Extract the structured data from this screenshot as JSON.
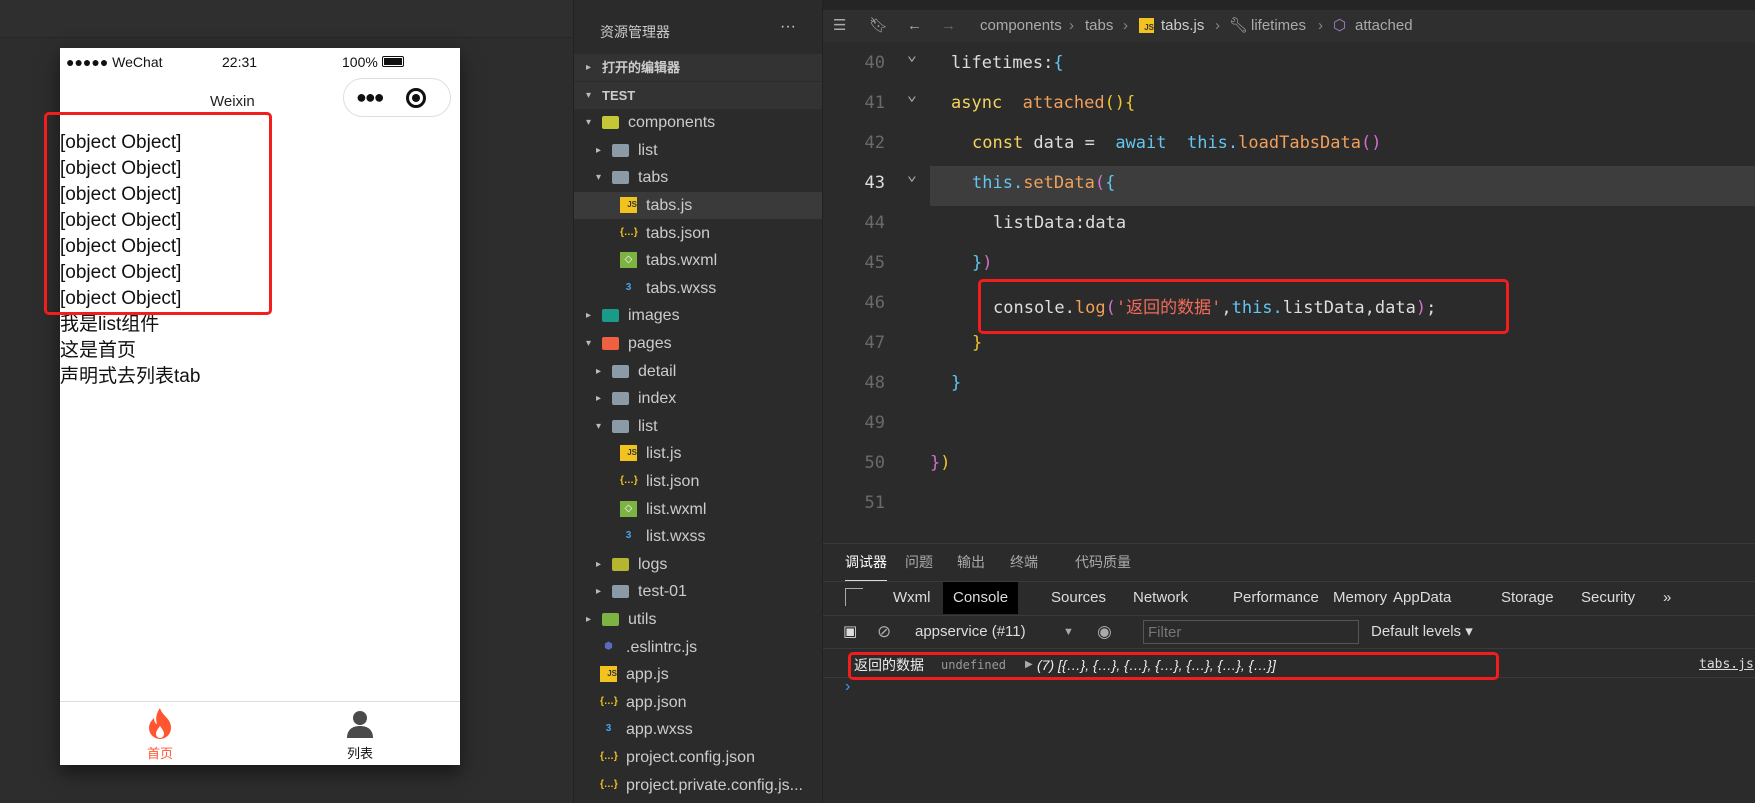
{
  "simulator": {
    "status": {
      "signal": "●●●●● WeChat",
      "time": "22:31",
      "battery": "100%"
    },
    "nav_title": "Weixin",
    "capsule_icons": [
      "more-icon",
      "record-icon"
    ],
    "content_lines": [
      "[object Object]",
      "[object Object]",
      "[object Object]",
      "[object Object]",
      "[object Object]",
      "[object Object]",
      "[object Object]",
      "我是list组件",
      "这是首页",
      "声明式去列表tab"
    ],
    "tabbar": [
      {
        "label": "首页",
        "icon": "fire-icon",
        "active": true,
        "color": "#ff5530"
      },
      {
        "label": "列表",
        "icon": "user-icon",
        "active": false,
        "color": "#111111"
      }
    ]
  },
  "explorer": {
    "title": "资源管理器",
    "more": "···",
    "rows": [
      {
        "label": "打开的编辑器",
        "type": "section",
        "arrow": "▸",
        "level": 0
      },
      {
        "label": "TEST",
        "type": "section",
        "arrow": "▾",
        "level": 0
      },
      {
        "label": "components",
        "type": "folder-open",
        "arrow": "▾",
        "level": 1,
        "icon_color": "#c6c736"
      },
      {
        "label": "list",
        "type": "folder",
        "arrow": "▸",
        "level": 2,
        "icon_color": "#8a9aa6"
      },
      {
        "label": "tabs",
        "type": "folder-open",
        "arrow": "▾",
        "level": 2,
        "icon_color": "#8a9aa6"
      },
      {
        "label": "tabs.js",
        "type": "js",
        "level": 3,
        "selected": true
      },
      {
        "label": "tabs.json",
        "type": "json",
        "level": 3
      },
      {
        "label": "tabs.wxml",
        "type": "wxml",
        "level": 3
      },
      {
        "label": "tabs.wxss",
        "type": "wxss",
        "level": 3
      },
      {
        "label": "images",
        "type": "folder",
        "arrow": "▸",
        "level": 1,
        "icon_color": "#1a9a88"
      },
      {
        "label": "pages",
        "type": "folder-open",
        "arrow": "▾",
        "level": 1,
        "icon_color": "#f06040"
      },
      {
        "label": "detail",
        "type": "folder",
        "arrow": "▸",
        "level": 2,
        "icon_color": "#8a9aa6"
      },
      {
        "label": "index",
        "type": "folder",
        "arrow": "▸",
        "level": 2,
        "icon_color": "#8a9aa6"
      },
      {
        "label": "list",
        "type": "folder-open",
        "arrow": "▾",
        "level": 2,
        "icon_color": "#8a9aa6"
      },
      {
        "label": "list.js",
        "type": "js",
        "level": 3
      },
      {
        "label": "list.json",
        "type": "json",
        "level": 3
      },
      {
        "label": "list.wxml",
        "type": "wxml",
        "level": 3
      },
      {
        "label": "list.wxss",
        "type": "wxss",
        "level": 3
      },
      {
        "label": "logs",
        "type": "folder",
        "arrow": "▸",
        "level": 2,
        "icon_color": "#b5b530"
      },
      {
        "label": "test-01",
        "type": "folder",
        "arrow": "▸",
        "level": 2,
        "icon_color": "#8a9aa6"
      },
      {
        "label": "utils",
        "type": "folder",
        "arrow": "▸",
        "level": 1,
        "icon_color": "#7cb342"
      },
      {
        "label": ".eslintrc.js",
        "type": "eslint",
        "level": 1
      },
      {
        "label": "app.js",
        "type": "js",
        "level": 1
      },
      {
        "label": "app.json",
        "type": "json",
        "level": 1
      },
      {
        "label": "app.wxss",
        "type": "wxss",
        "level": 1
      },
      {
        "label": "project.config.json",
        "type": "json",
        "level": 1
      },
      {
        "label": "project.private.config.js...",
        "type": "json",
        "level": 1
      }
    ]
  },
  "editor": {
    "breadcrumb": [
      "components",
      "tabs",
      "tabs.js",
      "lifetimes",
      "attached"
    ],
    "current_line": 43,
    "lines": [
      {
        "n": 40,
        "fold": true,
        "indent": 1,
        "tokens": [
          [
            "lifetimes:",
            "df"
          ],
          [
            "{",
            "cy"
          ]
        ]
      },
      {
        "n": 41,
        "fold": true,
        "indent": 1,
        "tokens": [
          [
            "async",
            "kw"
          ],
          [
            "  ",
            "df"
          ],
          [
            "attached",
            "fn"
          ],
          [
            "()",
            "yl"
          ],
          [
            "{",
            "yl"
          ]
        ]
      },
      {
        "n": 42,
        "indent": 2,
        "tokens": [
          [
            "const",
            "kw"
          ],
          [
            " data = ",
            "df"
          ],
          [
            " await",
            "cy"
          ],
          [
            "  this.",
            "cy"
          ],
          [
            "loadTabsData",
            "fn"
          ],
          [
            "()",
            "pk"
          ]
        ]
      },
      {
        "n": 43,
        "fold": true,
        "indent": 2,
        "tokens": [
          [
            "this.",
            "cy"
          ],
          [
            "setData",
            "fn"
          ],
          [
            "(",
            "pk"
          ],
          [
            "{",
            "cy"
          ]
        ]
      },
      {
        "n": 44,
        "indent": 3,
        "tokens": [
          [
            "listData:",
            "df"
          ],
          [
            "data",
            "df"
          ]
        ]
      },
      {
        "n": 45,
        "indent": 2,
        "tokens": [
          [
            "}",
            "cy"
          ],
          [
            ")",
            "pk"
          ]
        ]
      },
      {
        "n": 46,
        "indent": 3,
        "tokens": [
          [
            "console.",
            "df"
          ],
          [
            "log",
            "fn"
          ],
          [
            "(",
            "pk"
          ],
          [
            "'返回的数据'",
            "str"
          ],
          [
            ",",
            "df"
          ],
          [
            "this.",
            "cy"
          ],
          [
            "listData,data",
            "df"
          ],
          [
            ")",
            "pk"
          ],
          [
            ";",
            "df"
          ]
        ]
      },
      {
        "n": 47,
        "indent": 2,
        "tokens": [
          [
            "}",
            "yl"
          ]
        ]
      },
      {
        "n": 48,
        "indent": 1,
        "tokens": [
          [
            "}",
            "cy"
          ]
        ]
      },
      {
        "n": 49,
        "indent": 0,
        "tokens": []
      },
      {
        "n": 50,
        "indent": 0,
        "tokens": [
          [
            "}",
            "pk"
          ],
          [
            ")",
            "yl"
          ]
        ]
      },
      {
        "n": 51,
        "indent": 0,
        "tokens": []
      }
    ]
  },
  "panel": {
    "tabs": [
      "调试器",
      "问题",
      "输出",
      "终端",
      "代码质量"
    ],
    "active_tab": "调试器",
    "devtools_tabs": [
      "Wxml",
      "Console",
      "Sources",
      "Network",
      "Performance",
      "Memory",
      "AppData",
      "Storage",
      "Security",
      "»"
    ],
    "active_devtools_tab": "Console",
    "context": "appservice (#11)",
    "filter_placeholder": "Filter",
    "levels": "Default levels ▾",
    "log": {
      "label": "返回的数据",
      "undefined": "undefined",
      "array": "(7) [{…}, {…}, {…}, {…}, {…}, {…}, {…}]",
      "source": "tabs.js"
    },
    "prompt": "›"
  },
  "colors": {
    "highlight_box": "#f21d1d",
    "accent": "#ff5530"
  }
}
